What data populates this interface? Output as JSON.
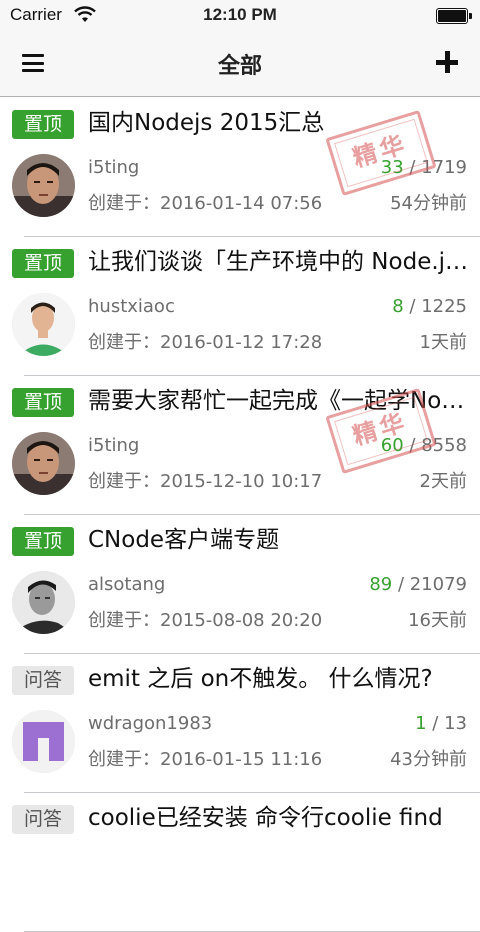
{
  "status_bar": {
    "carrier": "Carrier",
    "time": "12:10 PM"
  },
  "nav": {
    "title": "全部"
  },
  "stamp_label": "精华",
  "topics": [
    {
      "tag": "置顶",
      "tag_type": "top",
      "title": "国内Nodejs 2015汇总",
      "author": "i5ting",
      "replies": "33",
      "visits": "1719",
      "created": "创建于：2016-01-14 07:56",
      "ago": "54分钟前",
      "good": true,
      "avatar": "avatar-1"
    },
    {
      "tag": "置顶",
      "tag_type": "top",
      "title": "让我们谈谈「生产环境中的 Node.js」",
      "author": "hustxiaoc",
      "replies": "8",
      "visits": "1225",
      "created": "创建于：2016-01-12 17:28",
      "ago": "1天前",
      "good": false,
      "avatar": "avatar-2"
    },
    {
      "tag": "置顶",
      "tag_type": "top",
      "title": "需要大家帮忙一起完成《一起学Node.js》",
      "author": "i5ting",
      "replies": "60",
      "visits": "8558",
      "created": "创建于：2015-12-10 10:17",
      "ago": "2天前",
      "good": true,
      "avatar": "avatar-1"
    },
    {
      "tag": "置顶",
      "tag_type": "top",
      "title": "CNode客户端专题",
      "author": "alsotang",
      "replies": "89",
      "visits": "21079",
      "created": "创建于：2015-08-08 20:20",
      "ago": "16天前",
      "good": false,
      "avatar": "avatar-3"
    },
    {
      "tag": "问答",
      "tag_type": "qa",
      "title": "emit 之后 on不触发。 什么情况?",
      "author": "wdragon1983",
      "replies": "1",
      "visits": "13",
      "created": "创建于：2016-01-15 11:16",
      "ago": "43分钟前",
      "good": false,
      "avatar": "avatar-4"
    },
    {
      "tag": "问答",
      "tag_type": "qa",
      "title": "coolie已经安装  命令行coolie  find",
      "author": "",
      "replies": "",
      "visits": "",
      "created": "",
      "ago": "",
      "good": false,
      "avatar": ""
    }
  ]
}
